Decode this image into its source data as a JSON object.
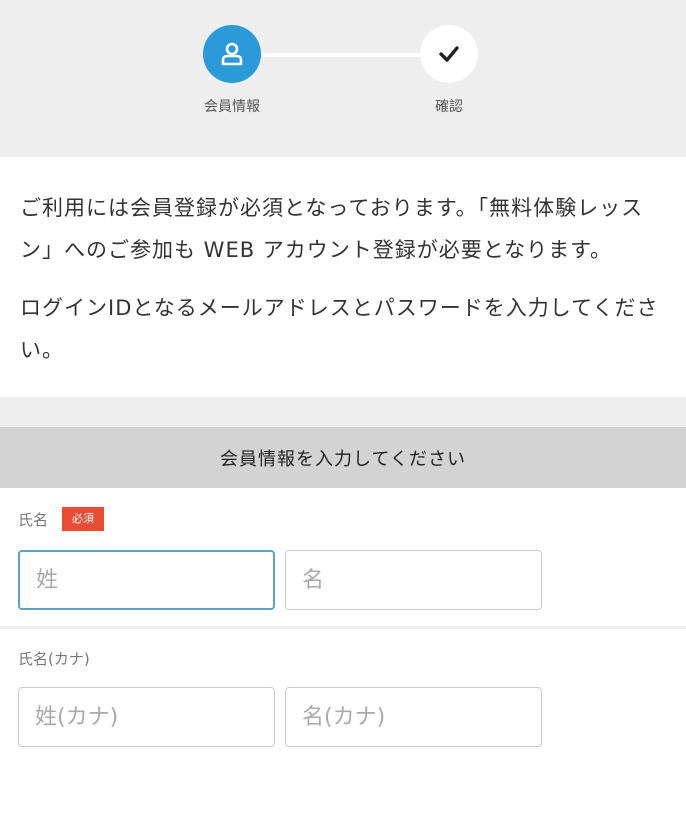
{
  "stepper": {
    "steps": [
      {
        "label": "会員情報",
        "icon": "user-icon",
        "state": "active"
      },
      {
        "label": "確認",
        "icon": "check-icon",
        "state": "pending"
      }
    ],
    "colors": {
      "active": "#2a9ad9",
      "pending": "#ffffff"
    }
  },
  "intro": {
    "paragraph1": "ご利用には会員登録が必須となっております。「無料体験レッスン」へのご参加も WEB アカウント登録が必要となります。",
    "paragraph2": "ログインIDとなるメールアドレスとパスワードを入力してください。"
  },
  "form": {
    "section_title": "会員情報を入力してください",
    "name": {
      "label": "氏名",
      "required_badge": "必須",
      "last_placeholder": "姓",
      "first_placeholder": "名"
    },
    "name_kana": {
      "label": "氏名(カナ)",
      "last_placeholder": "姓(カナ)",
      "first_placeholder": "名(カナ)"
    }
  }
}
